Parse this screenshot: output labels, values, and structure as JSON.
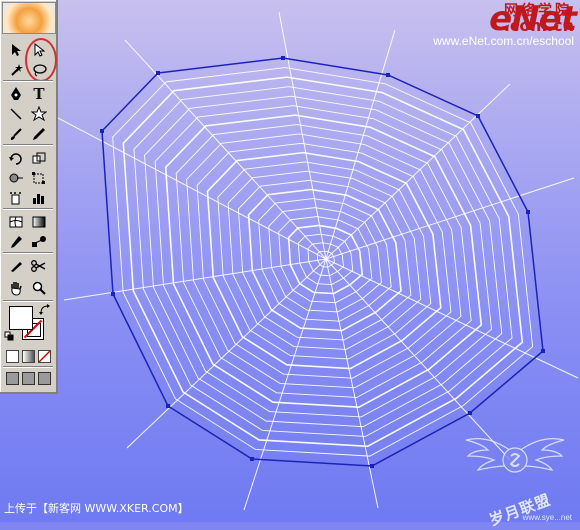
{
  "brand": {
    "logo_text": "eNet",
    "logo_cn": "网络学院",
    "logo_com": ".com.cn",
    "url": "www.eNet.com.cn/eschool"
  },
  "caption": "上传于【新客网 WWW.XKER.COM】",
  "seal": {
    "text": "岁月联盟",
    "sub": "www.sye...net"
  },
  "toolbox": {
    "tools": [
      {
        "name": "selection-tool-icon"
      },
      {
        "name": "direct-selection-tool-icon"
      },
      {
        "name": "magic-wand-tool-icon"
      },
      {
        "name": "lasso-tool-icon"
      },
      {
        "name": "pen-tool-icon"
      },
      {
        "name": "type-tool-icon"
      },
      {
        "name": "line-segment-tool-icon"
      },
      {
        "name": "star-tool-icon"
      },
      {
        "name": "paintbrush-tool-icon"
      },
      {
        "name": "pencil-tool-icon"
      },
      {
        "name": "rotate-tool-icon"
      },
      {
        "name": "scale-tool-icon"
      },
      {
        "name": "warp-tool-icon"
      },
      {
        "name": "free-transform-tool-icon"
      },
      {
        "name": "symbol-sprayer-tool-icon"
      },
      {
        "name": "column-graph-tool-icon"
      },
      {
        "name": "mesh-tool-icon"
      },
      {
        "name": "gradient-tool-icon"
      },
      {
        "name": "eyedropper-tool-icon"
      },
      {
        "name": "blend-tool-icon"
      },
      {
        "name": "slice-tool-icon"
      },
      {
        "name": "scissors-tool-icon"
      },
      {
        "name": "hand-tool-icon"
      },
      {
        "name": "zoom-tool-icon"
      }
    ],
    "type_tool_glyph": "T"
  },
  "colors": {
    "stroke_outline": "#1a23b8",
    "web_strands": "#ffffff",
    "highlight": "#d23030",
    "brand_red": "#c0181c"
  }
}
